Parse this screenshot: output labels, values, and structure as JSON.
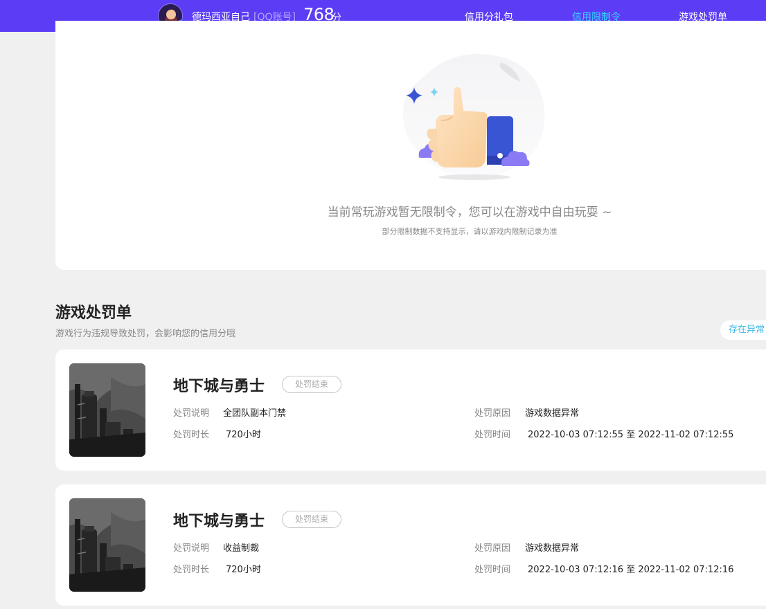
{
  "header": {
    "username": "德玛西亚自己",
    "account_type": "[QQ账号]",
    "score": "768",
    "score_unit": "分",
    "tabs": [
      {
        "label": "信用分礼包",
        "active": false
      },
      {
        "label": "信用限制令",
        "active": true
      },
      {
        "label": "游戏处罚单",
        "active": false
      }
    ]
  },
  "restrictions": {
    "empty_title": "当前常玩游戏暂无限制令，您可以在游戏中自由玩耍 ~",
    "empty_subtitle": "部分限制数据不支持显示，请以游戏内限制记录为准"
  },
  "penalties": {
    "title": "游戏处罚单",
    "subtitle": "游戏行为违规导致处罚，会影响您的信用分哦",
    "anomaly_button": "存在异常",
    "labels": {
      "description": "处罚说明",
      "duration": "处罚时长",
      "reason": "处罚原因",
      "time": "处罚时间"
    },
    "items": [
      {
        "game": "地下城与勇士",
        "status": "处罚结束",
        "description": "全团队副本门禁",
        "duration": "720小时",
        "reason": "游戏数据异常",
        "time": "2022-10-03 07:12:55 至 2022-11-02 07:12:55"
      },
      {
        "game": "地下城与勇士",
        "status": "处罚结束",
        "description": "收益制裁",
        "duration": "720小时",
        "reason": "游戏数据异常",
        "time": "2022-10-03 07:12:16 至 2022-11-02 07:12:16"
      }
    ]
  },
  "colors": {
    "header_bg": "#5c3df5",
    "active_tab": "#35d7ff",
    "page_bg": "#f0f0f0",
    "illustration_blue": "#3a55d4",
    "illustration_purple": "#8a7bf5"
  }
}
